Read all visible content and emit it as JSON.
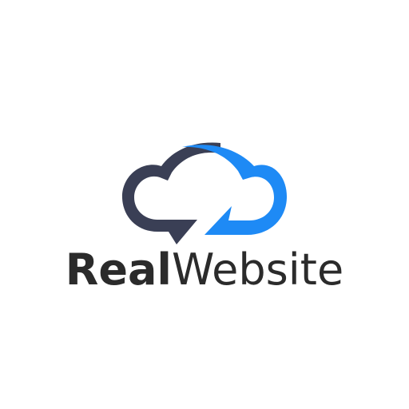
{
  "logo": {
    "wordmark_bold": "Real",
    "wordmark_light": "Website",
    "colors": {
      "dark": "#3a3f55",
      "blue": "#1e8af5",
      "text": "#2b2b2b"
    },
    "icon": "cloud-sync-icon"
  }
}
